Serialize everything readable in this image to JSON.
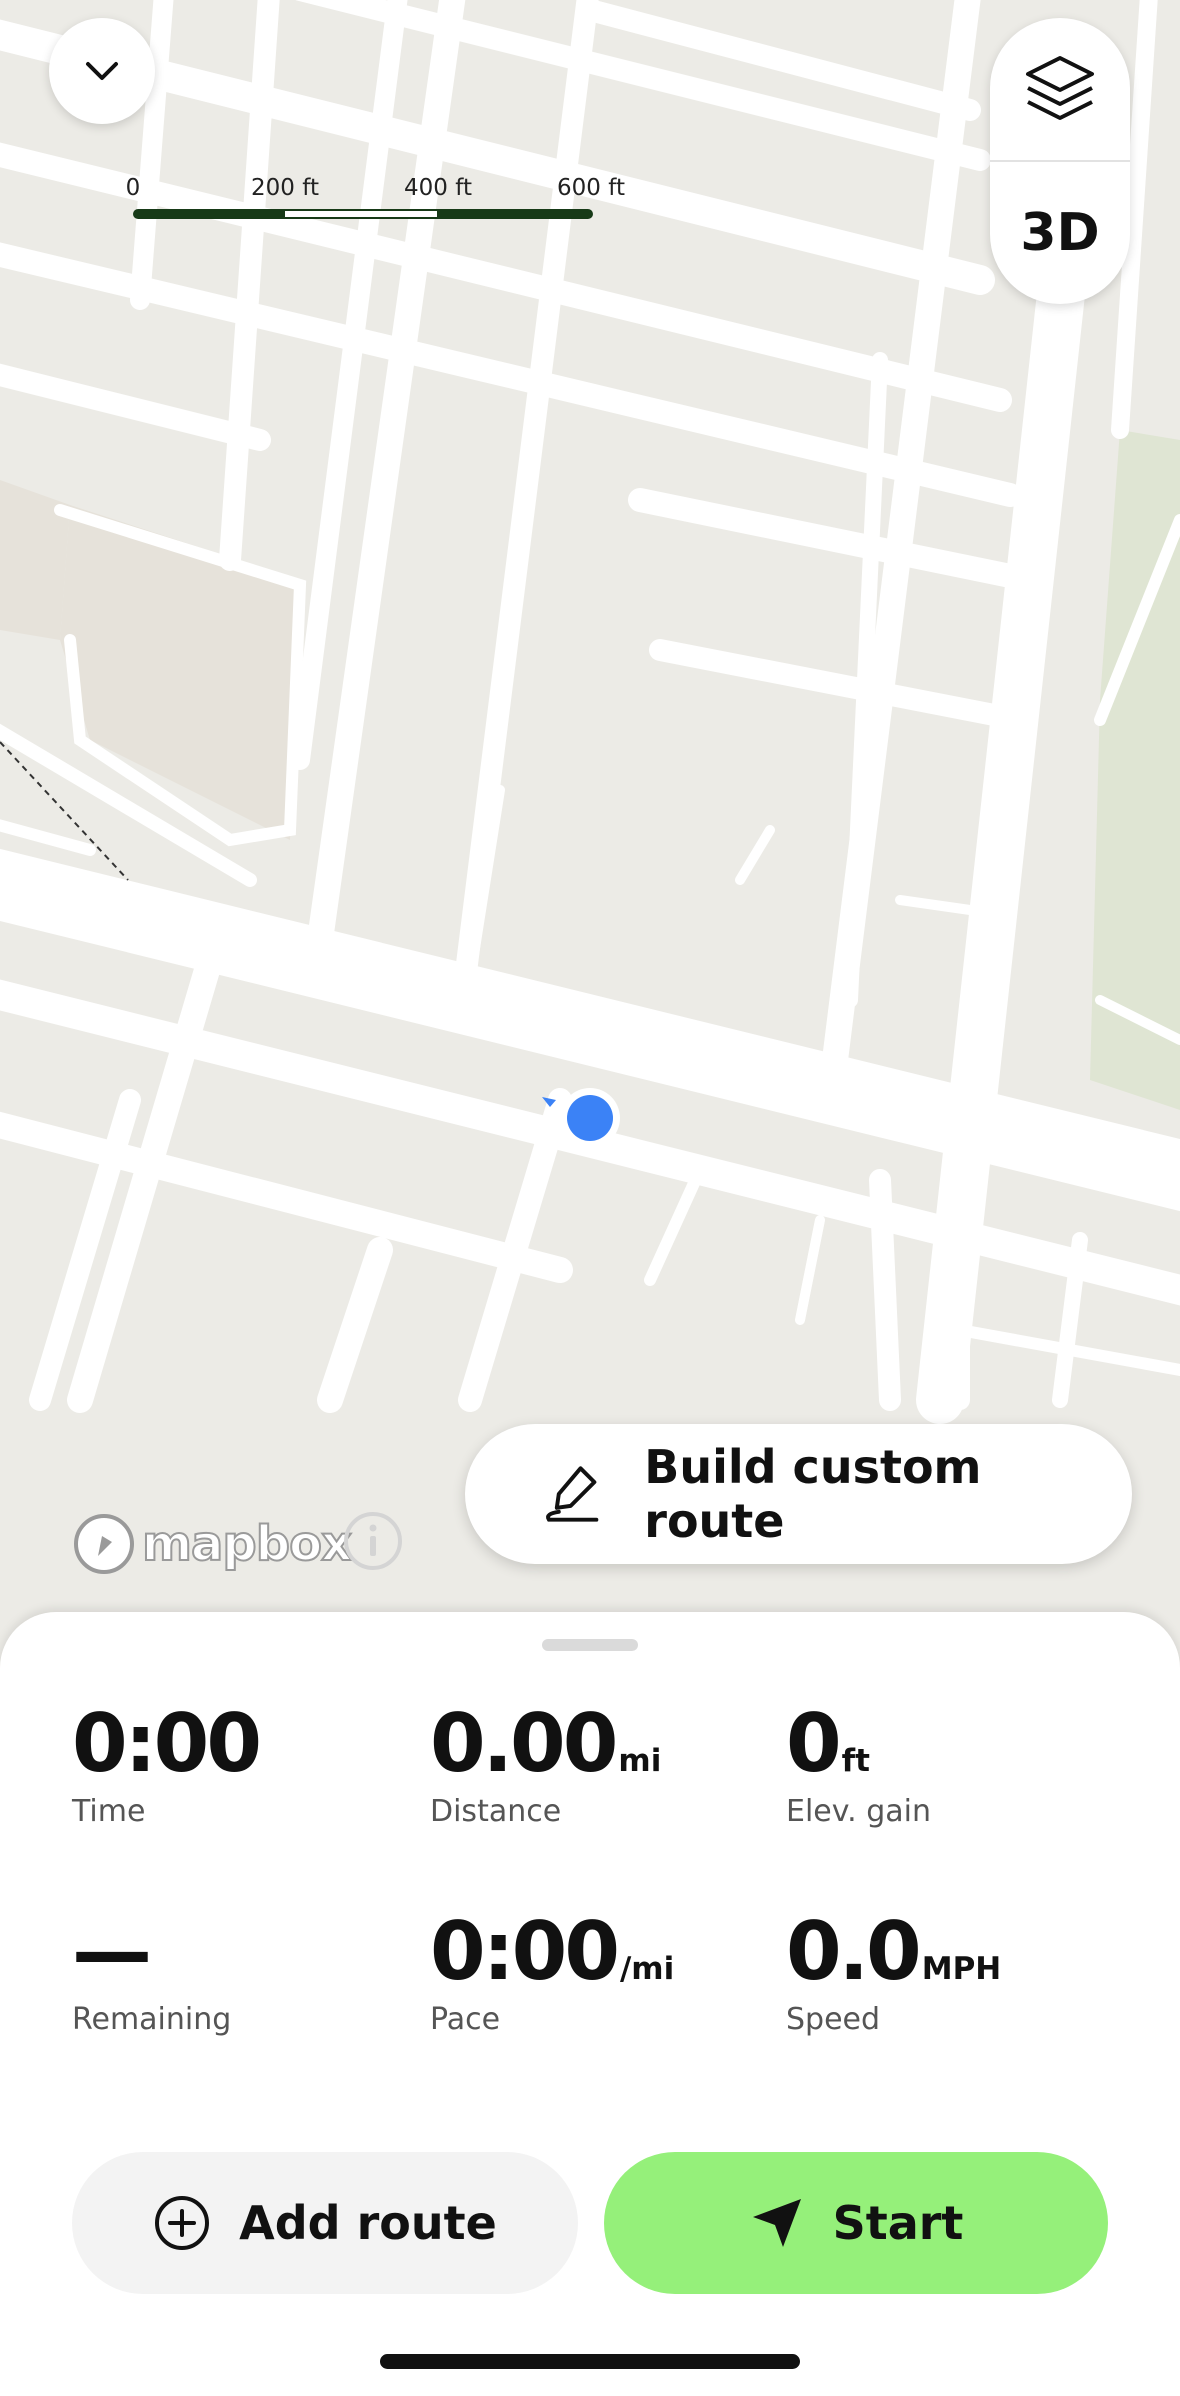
{
  "map": {
    "scale_labels": [
      "0",
      "200 ft",
      "400 ft",
      "600 ft"
    ],
    "attribution_logo": "mapbox",
    "controls": {
      "collapse_icon": "chevron-down-icon",
      "layers_icon": "layers-icon",
      "three_d_label": "3D"
    }
  },
  "build_custom_route": {
    "label": "Build custom route",
    "icon": "draw-route-icon"
  },
  "stats": [
    {
      "value": "0:00",
      "unit": "",
      "label": "Time"
    },
    {
      "value": "0.00",
      "unit": "mi",
      "label": "Distance"
    },
    {
      "value": "0",
      "unit": "ft",
      "label": "Elev. gain"
    },
    {
      "value": "—",
      "unit": "",
      "label": "Remaining"
    },
    {
      "value": "0:00",
      "unit": "/mi",
      "label": "Pace"
    },
    {
      "value": "0.0",
      "unit": "MPH",
      "label": "Speed"
    }
  ],
  "actions": {
    "add_route": {
      "label": "Add route",
      "icon": "plus-circle-icon"
    },
    "start": {
      "label": "Start",
      "icon": "navigation-arrow-icon"
    }
  },
  "colors": {
    "start_button": "#95f07a",
    "location_dot": "#3b82f6",
    "scalebar": "#173a17"
  }
}
